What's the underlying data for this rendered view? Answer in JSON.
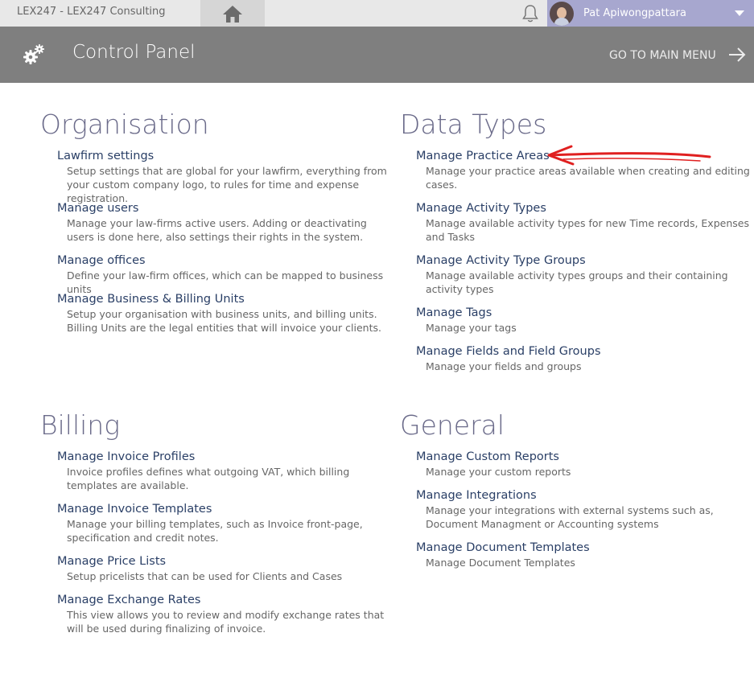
{
  "topbar": {
    "brand": "LEX247   -  LEX247 Consulting",
    "user_name": "Pat Apiwongpattara"
  },
  "header": {
    "title": "Control Panel",
    "goto_label": "GO TO MAIN MENU"
  },
  "sections": {
    "organisation": {
      "title": "Organisation",
      "items": [
        {
          "label": "Lawfirm settings",
          "desc": "Setup settings that are global for your lawfirm, everything from your custom company logo, to rules for time and expense registration."
        },
        {
          "label": "Manage users",
          "desc": "Manage your law-firms active users. Adding or deactivating users is done here, also settings their rights in the system."
        },
        {
          "label": "Manage offices",
          "desc": "Define your law-firm offices, which can be mapped to business units"
        },
        {
          "label": "Manage Business & Billing Units",
          "desc": "Setup your organisation with business units, and billing units. Billing Units are the legal entities that will invoice your clients."
        }
      ]
    },
    "data_types": {
      "title": "Data Types",
      "items": [
        {
          "label": "Manage Practice Areas",
          "desc": "Manage your practice areas available when creating and editing cases."
        },
        {
          "label": "Manage Activity Types",
          "desc": "Manage available activity types for new Time records, Expenses and Tasks"
        },
        {
          "label": "Manage Activity Type Groups",
          "desc": "Manage available activity types groups and their containing activity types"
        },
        {
          "label": "Manage Tags",
          "desc": "Manage your tags"
        },
        {
          "label": "Manage Fields and Field Groups",
          "desc": "Manage your fields and groups"
        }
      ]
    },
    "billing": {
      "title": "Billing",
      "items": [
        {
          "label": "Manage Invoice Profiles",
          "desc": "Invoice profiles defines what outgoing VAT, which billing templates are available."
        },
        {
          "label": "Manage Invoice Templates",
          "desc": "Manage your billing templates, such as Invoice front-page, specification and credit notes."
        },
        {
          "label": "Manage Price Lists",
          "desc": "Setup pricelists that can be used for Clients and Cases"
        },
        {
          "label": "Manage Exchange Rates",
          "desc": "This view allows you to review and modify exchange rates that will be used during finalizing of invoice."
        }
      ]
    },
    "general": {
      "title": "General",
      "items": [
        {
          "label": "Manage Custom Reports",
          "desc": "Manage your custom reports"
        },
        {
          "label": "Manage Integrations",
          "desc": "Manage your integrations with external systems such as, Document Managment or Accounting systems"
        },
        {
          "label": "Manage Document Templates",
          "desc": "Manage Document Templates"
        }
      ]
    }
  },
  "colors": {
    "header_bg": "#7f7f7f",
    "user_bg": "#a7a7cf",
    "section_title": "#6b6b8a",
    "link": "#2a3f66",
    "annotation": "#e02020"
  }
}
